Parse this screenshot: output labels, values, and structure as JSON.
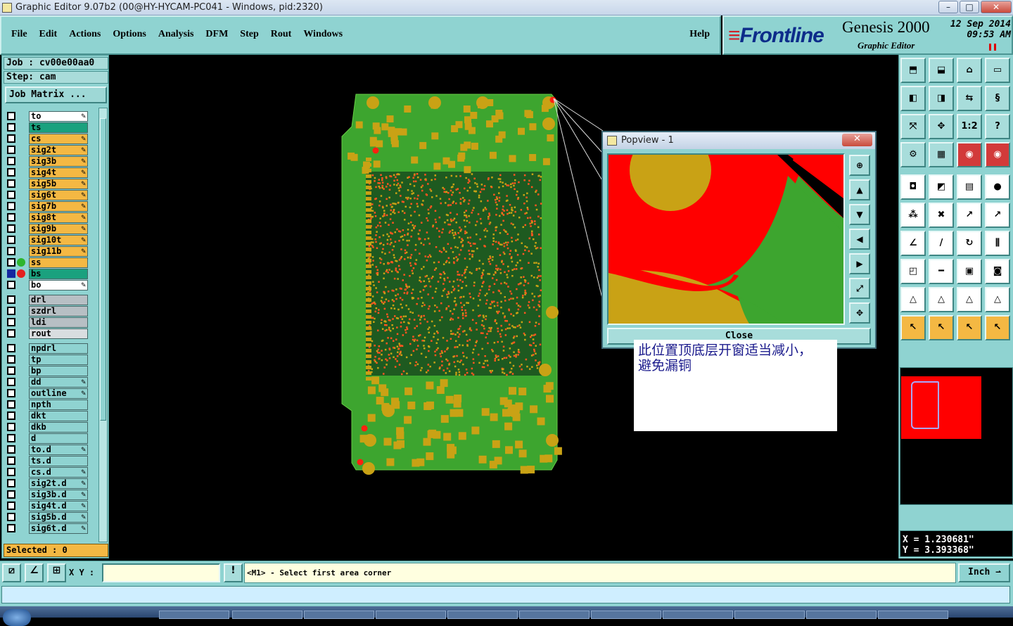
{
  "window": {
    "title": "Graphic Editor 9.07b2 (00@HY-HYCAM-PC041 - Windows, pid:2320)",
    "min": "–",
    "max": "□",
    "close": "✕"
  },
  "menu": {
    "items": [
      "File",
      "Edit",
      "Actions",
      "Options",
      "Analysis",
      "DFM",
      "Step",
      "Rout",
      "Windows"
    ],
    "help": "Help"
  },
  "brand": {
    "logo": "Frontline",
    "product": "Genesis 2000",
    "subtitle": "Graphic Editor",
    "date": "12 Sep 2014",
    "time": "09:53 AM"
  },
  "job": {
    "job": "Job : cv00e00aa0",
    "step": "Step: cam",
    "matrix_button": "Job Matrix ..."
  },
  "layers": [
    {
      "name": "to",
      "color": "#ffffff",
      "pen": true
    },
    {
      "name": "ts",
      "color": "#1aa17e"
    },
    {
      "name": "cs",
      "color": "#f4b843",
      "pen": true
    },
    {
      "name": "sig2t",
      "color": "#f4b843",
      "pen": true
    },
    {
      "name": "sig3b",
      "color": "#f4b843",
      "pen": true
    },
    {
      "name": "sig4t",
      "color": "#f4b843",
      "pen": true
    },
    {
      "name": "sig5b",
      "color": "#f4b843",
      "pen": true
    },
    {
      "name": "sig6t",
      "color": "#f4b843",
      "pen": true
    },
    {
      "name": "sig7b",
      "color": "#f4b843",
      "pen": true
    },
    {
      "name": "sig8t",
      "color": "#f4b843",
      "pen": true
    },
    {
      "name": "sig9b",
      "color": "#f4b843",
      "pen": true
    },
    {
      "name": "sig10t",
      "color": "#f4b843",
      "pen": true
    },
    {
      "name": "sig11b",
      "color": "#f4b843",
      "pen": true
    },
    {
      "name": "ss",
      "color": "#f4b843",
      "dot": "#2db52d"
    },
    {
      "name": "bs",
      "color": "#1aa17e",
      "dot": "#e42020",
      "checked": true
    },
    {
      "name": "bo",
      "color": "#ffffff",
      "pen": true
    },
    {
      "name": "",
      "color": "none"
    },
    {
      "name": "drl",
      "color": "#b7bfc4"
    },
    {
      "name": "szdrl",
      "color": "#b7bfc4"
    },
    {
      "name": "ldi",
      "color": "#b7bfc4"
    },
    {
      "name": "rout",
      "color": "#d9dde0"
    },
    {
      "name": "",
      "color": "none"
    },
    {
      "name": "npdrl",
      "color": "#8fd3d1"
    },
    {
      "name": "tp",
      "color": "#8fd3d1"
    },
    {
      "name": "bp",
      "color": "#8fd3d1"
    },
    {
      "name": "dd",
      "color": "#8fd3d1",
      "pen": true
    },
    {
      "name": "outline",
      "color": "#8fd3d1",
      "pen": true
    },
    {
      "name": "npth",
      "color": "#8fd3d1"
    },
    {
      "name": "dkt",
      "color": "#8fd3d1"
    },
    {
      "name": "dkb",
      "color": "#8fd3d1"
    },
    {
      "name": "d",
      "color": "#8fd3d1"
    },
    {
      "name": "to.d",
      "color": "#8fd3d1",
      "pen": true
    },
    {
      "name": "ts.d",
      "color": "#8fd3d1"
    },
    {
      "name": "cs.d",
      "color": "#8fd3d1",
      "pen": true
    },
    {
      "name": "sig2t.d",
      "color": "#8fd3d1",
      "pen": true
    },
    {
      "name": "sig3b.d",
      "color": "#8fd3d1",
      "pen": true
    },
    {
      "name": "sig4t.d",
      "color": "#8fd3d1",
      "pen": true
    },
    {
      "name": "sig5b.d",
      "color": "#8fd3d1",
      "pen": true
    },
    {
      "name": "sig6t.d",
      "color": "#8fd3d1",
      "pen": true
    }
  ],
  "selected": "Selected : 0",
  "popview": {
    "title": "Popview - 1",
    "close_label": "Close",
    "close_x": "✕"
  },
  "note": {
    "line1": "此位置顶底层开窗适当减小，",
    "line2": "避免漏铜"
  },
  "coords": {
    "x": "X = 1.230681\"",
    "y": "Y = 3.393368\""
  },
  "status": {
    "xy_label": "X Y :",
    "xy_value": "",
    "prompt": "<M1> - Select first area corner",
    "units": "Inch"
  },
  "colors": {
    "board_green": "#3da52f",
    "pad_gold": "#c9a215",
    "pad_red": "#ff2010",
    "panel": "#8fd3d1"
  }
}
